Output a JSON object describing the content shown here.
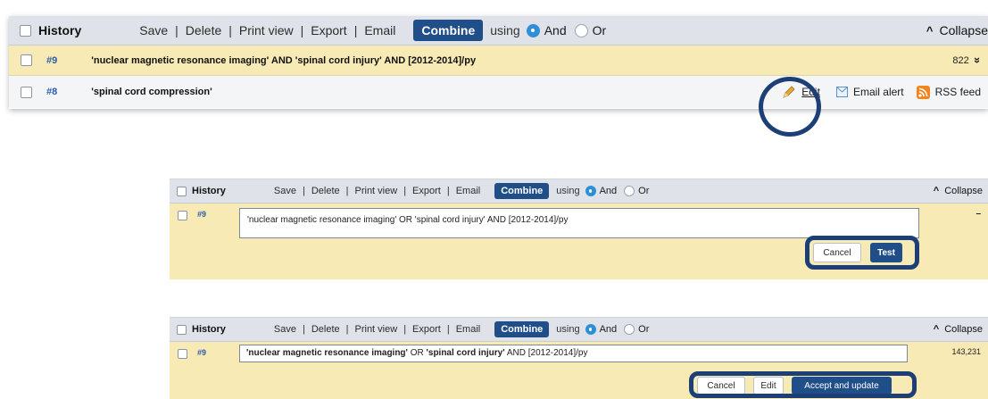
{
  "toolbar": {
    "title": "History",
    "save": "Save",
    "delete": "Delete",
    "print_view": "Print view",
    "export": "Export",
    "email": "Email",
    "separator": "|",
    "combine": "Combine",
    "using": "using",
    "and": "And",
    "or": "Or",
    "collapse": "Collapse",
    "collapse_icon": "^"
  },
  "panel1": {
    "rows": [
      {
        "num": "#9",
        "query": "'nuclear magnetic resonance imaging' AND 'spinal cord injury' AND [2012-2014]/py",
        "count": "822",
        "expand_icon": "»"
      },
      {
        "num": "#8",
        "query": "'spinal cord compression'",
        "actions": {
          "edit": "Edit",
          "email_alert": "Email alert",
          "rss_feed": "RSS feed"
        }
      }
    ]
  },
  "panel2": {
    "num": "#9",
    "edit_text": "'nuclear magnetic resonance imaging' OR 'spinal cord injury' AND [2012-2014]/py",
    "count": "–",
    "cancel": "Cancel",
    "test": "Test"
  },
  "panel3": {
    "num": "#9",
    "query_part1": "'nuclear magnetic resonance imaging'",
    "op1": " OR ",
    "query_part2": "'spinal cord injury'",
    "op2": " AND [2012-2014]/py",
    "count": "143,231",
    "cancel": "Cancel",
    "edit": "Edit",
    "accept": "Accept and update"
  },
  "colors": {
    "accent": "#1f4e88",
    "highlight_ring": "#1c3f78",
    "row_highlight": "#f8eab5",
    "header_bg": "#dfe3e9",
    "link": "#2a5caa",
    "radio_on": "#2f8fd6"
  }
}
